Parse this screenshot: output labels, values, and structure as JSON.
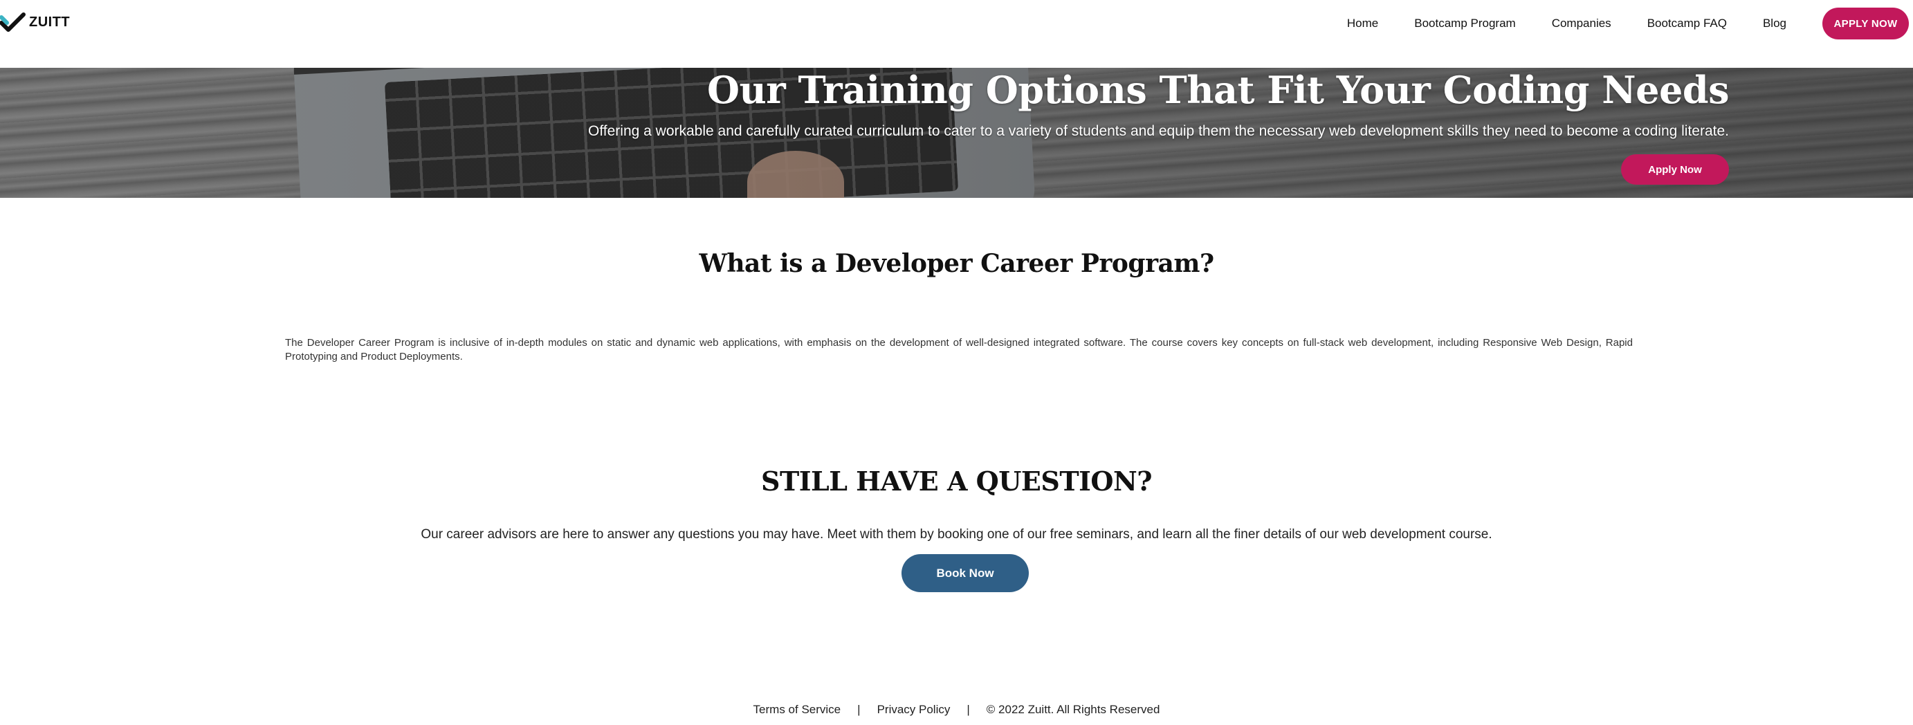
{
  "navbar": {
    "brand": "ZUITT",
    "links": [
      {
        "label": "Home"
      },
      {
        "label": "Bootcamp Program"
      },
      {
        "label": "Companies"
      },
      {
        "label": "Bootcamp FAQ"
      },
      {
        "label": "Blog"
      }
    ],
    "apply_label": "APPLY NOW"
  },
  "hero": {
    "title": "Our Training Options That Fit Your Coding Needs",
    "subtitle": "Offering a workable and carefully curated curriculum to cater to a variety of students and equip them the necessary web development skills they need to become a coding literate.",
    "apply_label": "Apply Now"
  },
  "program": {
    "title": "What is a Developer Career Program?",
    "text": "The Developer Career Program is inclusive of in-depth modules on static and dynamic web applications, with emphasis on the development of well-designed integrated software. The course covers key concepts on full-stack web development, including Responsive Web Design, Rapid Prototyping and Product Deployments."
  },
  "question": {
    "title": "STILL HAVE A QUESTION?",
    "text": "Our career advisors are here to answer any questions you may have. Meet with them by booking one of our free seminars, and learn all the finer details of our web development course.",
    "book_label": "Book Now"
  },
  "footer": {
    "terms": "Terms of Service",
    "privacy": "Privacy Policy",
    "separator": "|",
    "copyright": "© 2022 Zuitt. All Rights Reserved"
  },
  "colors": {
    "accent": "#c2185b",
    "book_button": "#2f5f87"
  }
}
